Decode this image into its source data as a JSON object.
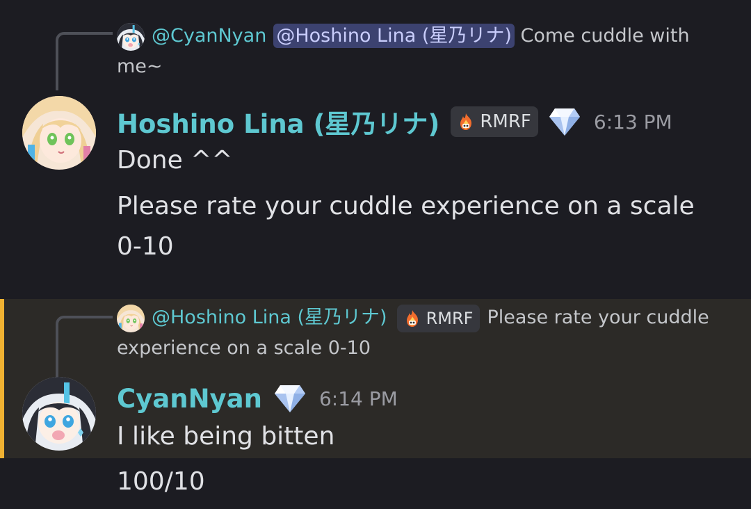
{
  "colors": {
    "background": "#1c1c22",
    "highlight_background": "#2c2a27",
    "highlight_bar": "#f0b232",
    "author_color": "#5ec8d1",
    "mention_bg": "#3c4270",
    "timestamp_color": "#9b9ca3"
  },
  "message1": {
    "reply": {
      "author": "@CyanNyan",
      "mention": "@Hoshino Lina (星乃リナ)",
      "text": " Come cuddle with me~",
      "avatar_icon": "cyan-avatar-icon"
    },
    "author": "Hoshino Lina (星乃リナ)",
    "role_badge": "RMRF",
    "role_icon": "fire-icon",
    "gem_icon": "diamond-icon",
    "timestamp": "6:13 PM",
    "lines": [
      "Done ^^",
      "Please rate your cuddle experience on a scale 0-10"
    ]
  },
  "message2": {
    "reply": {
      "author": "@Hoshino Lina (星乃リナ)",
      "role_badge": "RMRF",
      "text": "Please rate your cuddle experience on a scale 0-10",
      "avatar_icon": "lina-avatar-icon"
    },
    "author": "CyanNyan",
    "gem_icon": "diamond-icon",
    "timestamp": "6:14 PM",
    "lines": [
      "I like being bitten"
    ]
  },
  "followup": {
    "text": "100/10"
  }
}
